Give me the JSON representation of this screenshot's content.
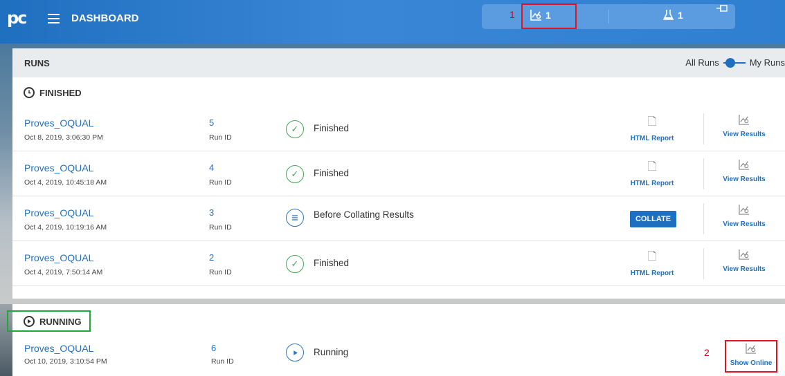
{
  "header": {
    "logo_text": "pc",
    "title": "DASHBOARD",
    "runs_count": "1",
    "tests_count": "1",
    "pin_icon": "pin-icon"
  },
  "annotations": {
    "label_1": "1",
    "label_2": "2"
  },
  "runs_panel": {
    "title": "RUNS",
    "toggle_left": "All Runs",
    "toggle_right": "My Runs"
  },
  "finished": {
    "heading": "FINISHED",
    "rows": [
      {
        "name": "Proves_OQUAL",
        "date": "Oct 8, 2019, 3:06:30 PM",
        "id": "5",
        "id_label": "Run ID",
        "status": "Finished",
        "left_action": "HTML Report",
        "right_action": "View Results"
      },
      {
        "name": "Proves_OQUAL",
        "date": "Oct 4, 2019, 10:45:18 AM",
        "id": "4",
        "id_label": "Run ID",
        "status": "Finished",
        "left_action": "HTML Report",
        "right_action": "View Results"
      },
      {
        "name": "Proves_OQUAL",
        "date": "Oct 4, 2019, 10:19:16 AM",
        "id": "3",
        "id_label": "Run ID",
        "status": "Before Collating Results",
        "left_action": "COLLATE",
        "right_action": "View Results"
      },
      {
        "name": "Proves_OQUAL",
        "date": "Oct 4, 2019, 7:50:14 AM",
        "id": "2",
        "id_label": "Run ID",
        "status": "Finished",
        "left_action": "HTML Report",
        "right_action": "View Results"
      }
    ]
  },
  "running": {
    "heading": "RUNNING",
    "rows": [
      {
        "name": "Proves_OQUAL",
        "date": "Oct 10, 2019, 3:10:54 PM",
        "id": "6",
        "id_label": "Run ID",
        "status": "Running",
        "action": "Show Online"
      }
    ]
  }
}
